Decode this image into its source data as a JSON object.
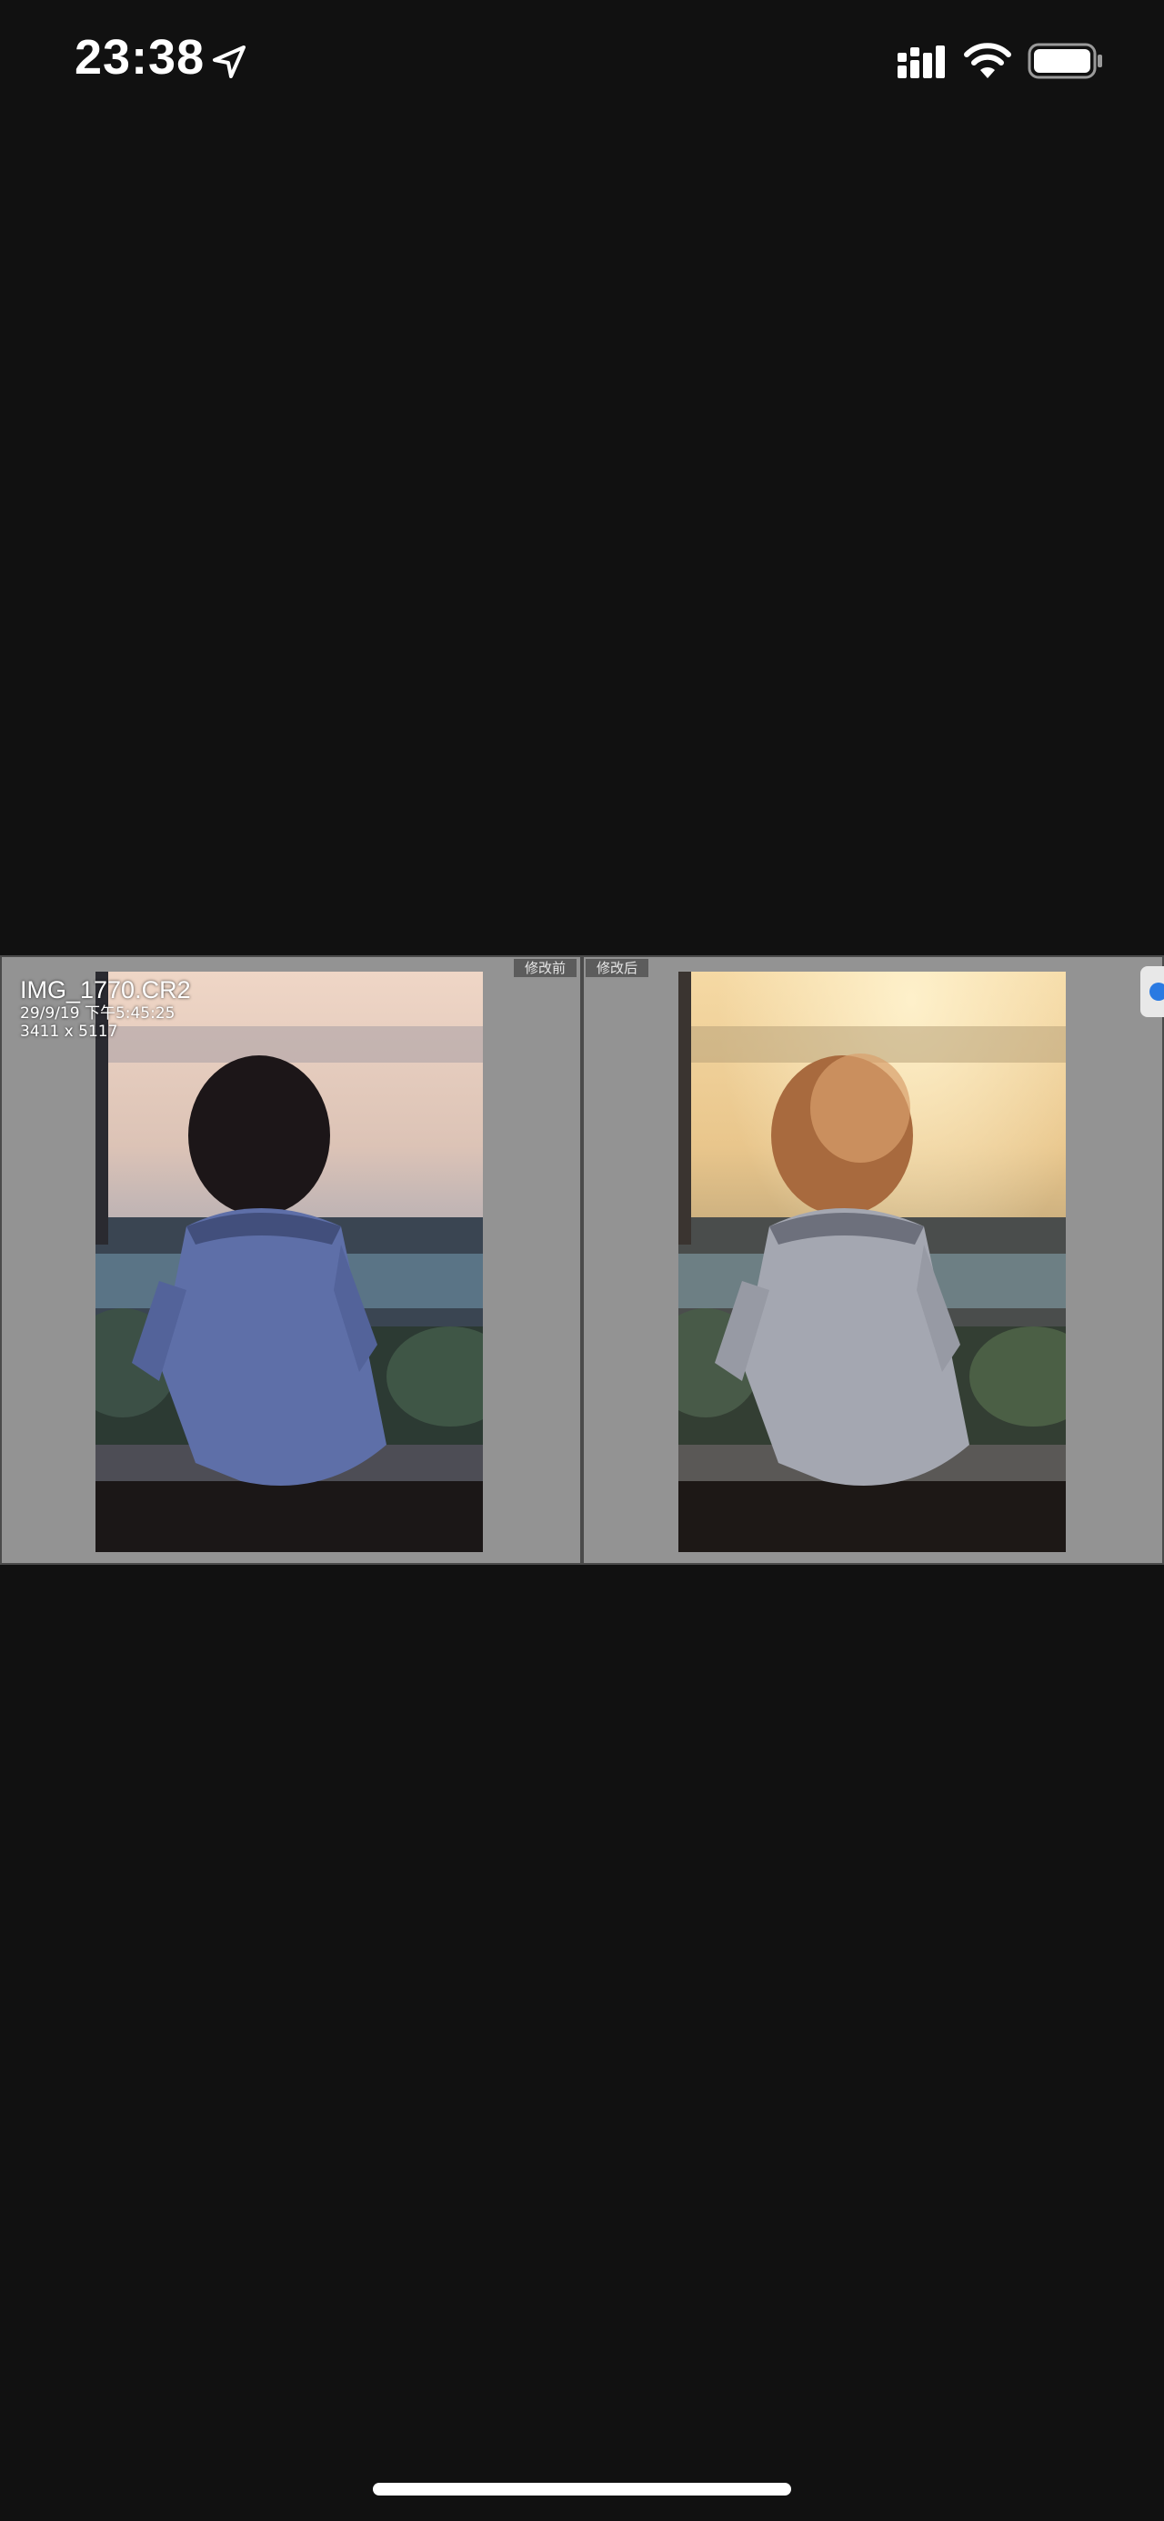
{
  "status_bar": {
    "time": "23:38",
    "icons": [
      "location-arrow-icon",
      "cellular-signal-icon",
      "wifi-icon",
      "battery-icon"
    ]
  },
  "photo_info": {
    "filename": "IMG_1770.CR2",
    "datetime": "29/9/19 下午5:45:25",
    "dimensions": "3411 x 5117"
  },
  "compare": {
    "before_label": "修改前",
    "after_label": "修改后"
  },
  "colors": {
    "background": "#111111",
    "pane": "#939393",
    "tag": "#5c5c5c",
    "accent": "#2a7ae2"
  }
}
